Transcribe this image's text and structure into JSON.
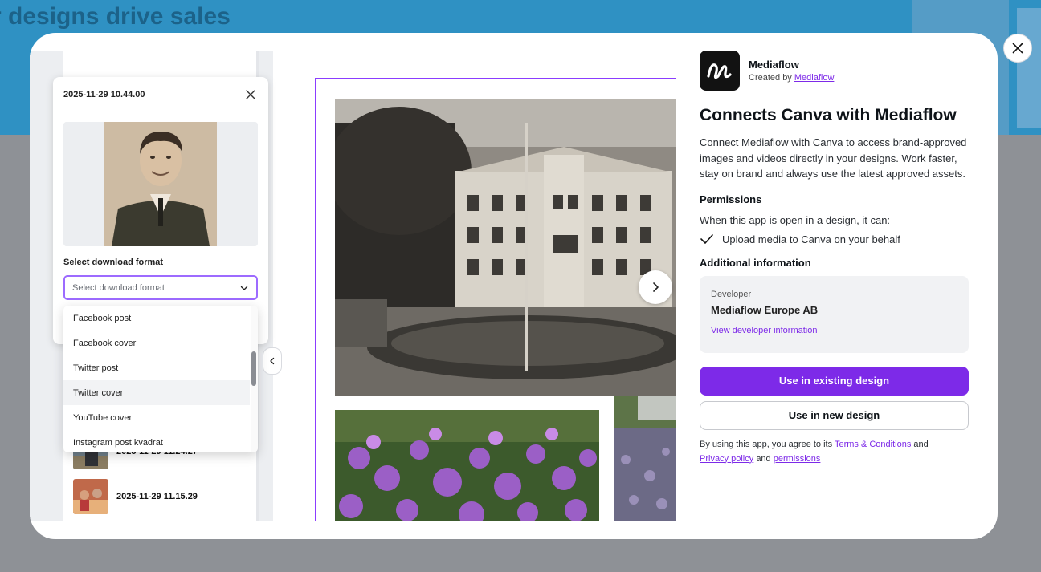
{
  "background": {
    "banner_title": "r designs drive sales"
  },
  "modal": {
    "close_label": "Close"
  },
  "preview_app": {
    "card": {
      "title": "2025-11-29 10.44.00",
      "format_label": "Select download format",
      "select_placeholder": "Select download format"
    },
    "dropdown_options": [
      "Facebook post",
      "Facebook cover",
      "Twitter post",
      "Twitter cover",
      "YouTube cover",
      "Instagram post kvadrat"
    ],
    "hovered_option": "Twitter cover",
    "list_items": [
      {
        "label": "2025-11-29 11.24.27"
      },
      {
        "label": "2025-11-29 11.15.29"
      }
    ]
  },
  "info": {
    "app_name": "Mediaflow",
    "created_by_prefix": "Created by",
    "created_by_link": "Mediaflow",
    "heading": "Connects Canva with Mediaflow",
    "description": "Connect Mediaflow with Canva to access brand-approved images and videos directly in your designs. Work faster, stay on brand and always use the latest approved assets.",
    "permissions_title": "Permissions",
    "permissions_intro": "When this app is open in a design, it can:",
    "permissions": [
      "Upload media to Canva on your behalf"
    ],
    "additional_title": "Additional information",
    "developer_label": "Developer",
    "developer_name": "Mediaflow Europe AB",
    "developer_link": "View developer information",
    "primary_button": "Use in existing design",
    "secondary_button": "Use in new design",
    "terms": {
      "prefix": "By using this app, you agree to its",
      "terms_link": "Terms & Conditions",
      "and1": "and",
      "privacy_link": "Privacy policy",
      "and2": "and",
      "permissions_link": "permissions"
    }
  },
  "colors": {
    "accent": "#7d2ae8",
    "selection": "#8b3dff",
    "banner": "#2f91c3"
  }
}
